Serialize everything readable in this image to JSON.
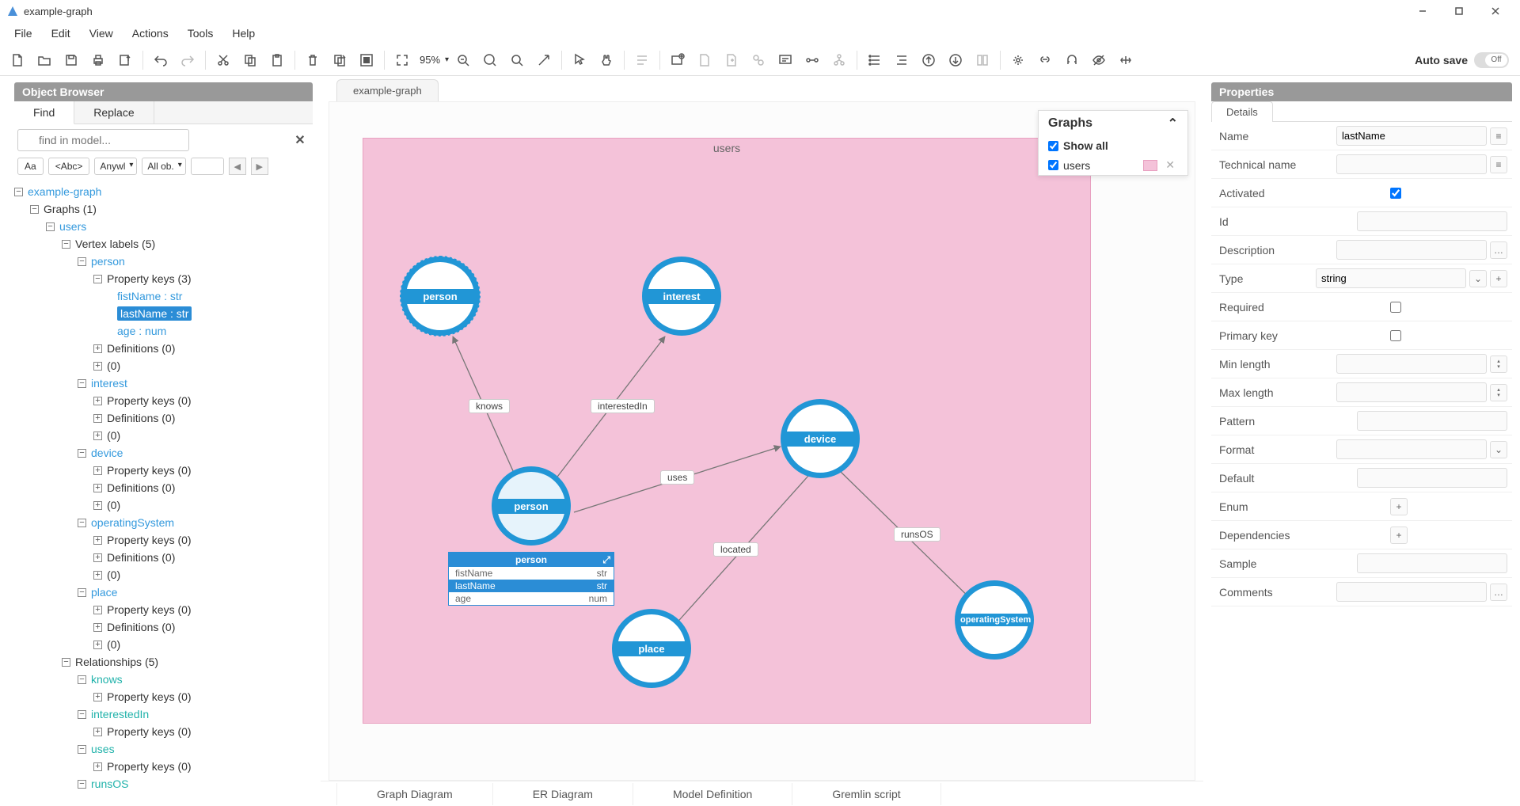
{
  "window": {
    "title": "example-graph"
  },
  "menu": {
    "items": [
      "File",
      "Edit",
      "View",
      "Actions",
      "Tools",
      "Help"
    ]
  },
  "toolbar": {
    "zoom": "95%",
    "autosave_label": "Auto save",
    "autosave_state": "Off"
  },
  "object_browser": {
    "title": "Object Browser",
    "tabs": {
      "find": "Find",
      "replace": "Replace"
    },
    "search_placeholder": "find in model...",
    "filters": {
      "case": "Aa",
      "word": "<Abc>",
      "scope": "Anywl",
      "type": "All ob."
    },
    "tree": {
      "root": "example-graph",
      "graphs_label": "Graphs (1)",
      "graph_name": "users",
      "vertex_labels_label": "Vertex labels (5)",
      "vertices": [
        {
          "name": "person",
          "props_label": "Property keys (3)",
          "props": [
            {
              "text": "fistName : str",
              "selected": false
            },
            {
              "text": "lastName : str",
              "selected": true
            },
            {
              "text": "age : num",
              "selected": false
            }
          ],
          "defs": "Definitions (0)",
          "zero": "(0)"
        },
        {
          "name": "interest",
          "props_label": "Property keys (0)",
          "defs": "Definitions (0)",
          "zero": "(0)"
        },
        {
          "name": "device",
          "props_label": "Property keys (0)",
          "defs": "Definitions (0)",
          "zero": "(0)"
        },
        {
          "name": "operatingSystem",
          "props_label": "Property keys (0)",
          "defs": "Definitions (0)",
          "zero": "(0)"
        },
        {
          "name": "place",
          "props_label": "Property keys (0)",
          "defs": "Definitions (0)",
          "zero": "(0)"
        }
      ],
      "relationships_label": "Relationships (5)",
      "relationships": [
        {
          "name": "knows",
          "props_label": "Property keys (0)"
        },
        {
          "name": "interestedIn",
          "props_label": "Property keys (0)"
        },
        {
          "name": "uses",
          "props_label": "Property keys (0)"
        },
        {
          "name": "runsOS"
        }
      ]
    }
  },
  "canvas": {
    "doc_tab": "example-graph",
    "graph_title": "users",
    "edges": {
      "knows": "knows",
      "interestedIn": "interestedIn",
      "uses": "uses",
      "located": "located",
      "runsOS": "runsOS"
    },
    "vertices": {
      "person_top": "person",
      "interest": "interest",
      "person_main": "person",
      "device": "device",
      "place": "place",
      "operatingSystem": "operatingSystem"
    },
    "popup": {
      "title": "person",
      "rows": [
        {
          "name": "fistName",
          "type": "str",
          "sel": false
        },
        {
          "name": "lastName",
          "type": "str",
          "sel": true
        },
        {
          "name": "age",
          "type": "num",
          "sel": false
        }
      ]
    },
    "graphs_panel": {
      "title": "Graphs",
      "show_all": "Show all",
      "items": [
        {
          "name": "users"
        }
      ]
    },
    "bottom_tabs": [
      "Graph Diagram",
      "ER Diagram",
      "Model Definition",
      "Gremlin script"
    ]
  },
  "properties": {
    "title": "Properties",
    "tab": "Details",
    "rows": {
      "name": {
        "label": "Name",
        "value": "lastName"
      },
      "technical_name": {
        "label": "Technical name",
        "value": ""
      },
      "activated": {
        "label": "Activated",
        "checked": true
      },
      "id": {
        "label": "Id",
        "value": ""
      },
      "description": {
        "label": "Description",
        "value": ""
      },
      "type": {
        "label": "Type",
        "value": "string"
      },
      "required": {
        "label": "Required",
        "checked": false
      },
      "primary_key": {
        "label": "Primary key",
        "checked": false
      },
      "min_length": {
        "label": "Min length",
        "value": ""
      },
      "max_length": {
        "label": "Max length",
        "value": ""
      },
      "pattern": {
        "label": "Pattern",
        "value": ""
      },
      "format": {
        "label": "Format",
        "value": ""
      },
      "default": {
        "label": "Default",
        "value": ""
      },
      "enum": {
        "label": "Enum"
      },
      "dependencies": {
        "label": "Dependencies"
      },
      "sample": {
        "label": "Sample",
        "value": ""
      },
      "comments": {
        "label": "Comments",
        "value": ""
      }
    }
  }
}
